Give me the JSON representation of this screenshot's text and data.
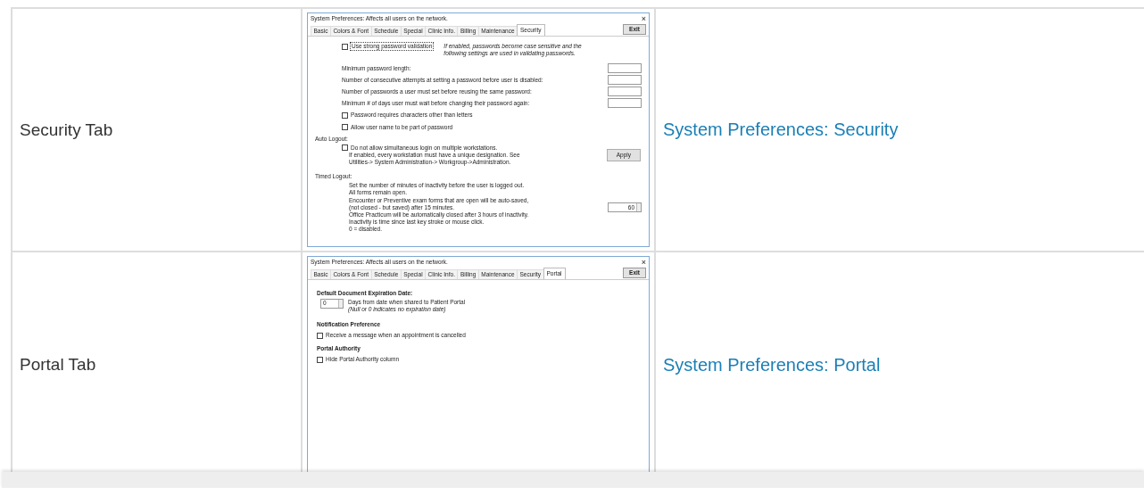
{
  "rows": [
    {
      "label": "Security Tab",
      "link": "System Preferences: Security",
      "screenshot": {
        "title": "System Preferences: Affects all users on the network.",
        "close": "×",
        "exit_button": "Exit",
        "tabs": [
          {
            "label": "Basic",
            "selected": false
          },
          {
            "label": "Colors & Font",
            "selected": false
          },
          {
            "label": "Schedule",
            "selected": false
          },
          {
            "label": "Special",
            "selected": false
          },
          {
            "label": "Clinic Info.",
            "selected": false
          },
          {
            "label": "Billing",
            "selected": false
          },
          {
            "label": "Maintenance",
            "selected": false
          },
          {
            "label": "Security",
            "selected": true
          }
        ],
        "blocks": [
          {
            "kind": "checkbox_note",
            "label": "Use strong password validation",
            "checked": false,
            "note": "If enabled, passwords become case sensitive and the following settings are used in validating passwords."
          },
          {
            "kind": "field",
            "label": "Minimum password length:"
          },
          {
            "kind": "field",
            "label": "Number of consecutive attempts at setting a password before user is disabled:"
          },
          {
            "kind": "field",
            "label": "Number of passwords a user must set before reusing the same password:"
          },
          {
            "kind": "field",
            "label": "Minimum # of days user must wait before changing their password again:"
          },
          {
            "kind": "checkbox",
            "label": "Password requires characters other than letters",
            "checked": false
          },
          {
            "kind": "checkbox",
            "label": "Allow user name to be part of password",
            "checked": false
          },
          {
            "kind": "label",
            "text": "Auto Logout:"
          },
          {
            "kind": "checkbox_button",
            "label": "Do not allow simultaneous login on multiple workstations.",
            "checked": false,
            "lines": [
              "If enabled, every workstation must have a unique designation. See",
              "Utilities-> System Administration-> Workgroup->Administration."
            ],
            "button": "Apply"
          },
          {
            "kind": "label",
            "text": "Timed Logout:"
          },
          {
            "kind": "lines_spinner",
            "lines": [
              "Set the number of minutes of inactivity before the user is logged out.",
              "All forms remain open.",
              "Encounter or Preventive exam forms that are open will be auto-saved,",
              "(not closed - but saved) after 15 minutes.",
              "Office Practicum will be automatically closed after 3 hours of inactivity.",
              "Inactivity is time since last key stroke or mouse click.",
              "0 = disabled."
            ],
            "value": "60"
          }
        ]
      }
    },
    {
      "label": "Portal Tab",
      "link": "System Preferences: Portal",
      "screenshot": {
        "title": "System Preferences: Affects all users on the network.",
        "close": "×",
        "exit_button": "Exit",
        "tabs": [
          {
            "label": "Basic",
            "selected": false
          },
          {
            "label": "Colors & Font",
            "selected": false
          },
          {
            "label": "Schedule",
            "selected": false
          },
          {
            "label": "Special",
            "selected": false
          },
          {
            "label": "Clinic Info.",
            "selected": false
          },
          {
            "label": "Billing",
            "selected": false
          },
          {
            "label": "Maintenance",
            "selected": false
          },
          {
            "label": "Security",
            "selected": false
          },
          {
            "label": "Portal",
            "selected": true
          }
        ],
        "blocks": [
          {
            "kind": "heading",
            "text": "Default Document Expiration Date:"
          },
          {
            "kind": "spinner_text",
            "value": "0",
            "text": "Days from date when shared to Patient Portal",
            "note": "(Null or 0 indicates no expiration date)"
          },
          {
            "kind": "heading",
            "text": "Notification Preference"
          },
          {
            "kind": "checkbox",
            "label": "Receive a message when an appointment is cancelled",
            "checked": false
          },
          {
            "kind": "heading",
            "text": "Portal Authority"
          },
          {
            "kind": "checkbox",
            "label": "Hide Portal Authority column",
            "checked": false
          }
        ]
      }
    }
  ]
}
